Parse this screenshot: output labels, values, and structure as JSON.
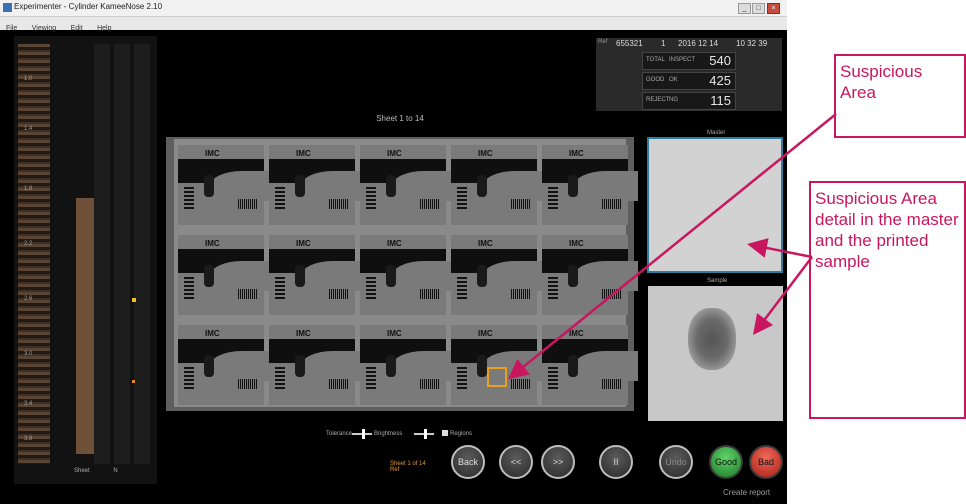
{
  "window": {
    "title": "Experimenter - Cylinder  KameeNose 2.10",
    "controls": [
      "_",
      "□",
      "×"
    ]
  },
  "menu": {
    "items": [
      "File",
      "Viewing",
      "Edit",
      "Help"
    ]
  },
  "left_panel": {
    "ticks": [
      "1.0",
      "1.4",
      "1.8",
      "2.2",
      "2.6",
      "3.0",
      "3.4",
      "3.8"
    ],
    "footer": [
      "Sheet",
      "N"
    ]
  },
  "info": {
    "id_label": "Ref",
    "id_value": "655321",
    "count": "1",
    "date": "2016 12 14",
    "time": "10 32 39",
    "rows": [
      {
        "label_a": "TOTAL",
        "label_b": "INSPECT",
        "value": "540"
      },
      {
        "label_a": "GOOD",
        "label_b": "OK",
        "value": "425"
      },
      {
        "label_a": "REJECT",
        "label_b": "NG",
        "value": "115"
      }
    ]
  },
  "sheet": {
    "title": "Sheet 1 to 14",
    "card_logo": "IMC"
  },
  "details": {
    "master_label": "Master",
    "sample_label": "Sample"
  },
  "controls": {
    "tolerance_label": "Tolerance",
    "brightness_label": "Brightness",
    "checkbox_label": "Regions"
  },
  "status": {
    "sheet_count": "Sheet 1 of 14",
    "flag": "Ref"
  },
  "buttons": {
    "back": "Back",
    "prev": "<<",
    "next": ">>",
    "pause": "II",
    "undo": "Undo",
    "good": "Good",
    "bad": "Bad"
  },
  "footer": {
    "create_report": "Create report"
  },
  "annotations": {
    "suspicious": "Suspicious Area",
    "detail": "Suspicious Area detail in the master and the printed sample",
    "color": "#c8175e"
  }
}
